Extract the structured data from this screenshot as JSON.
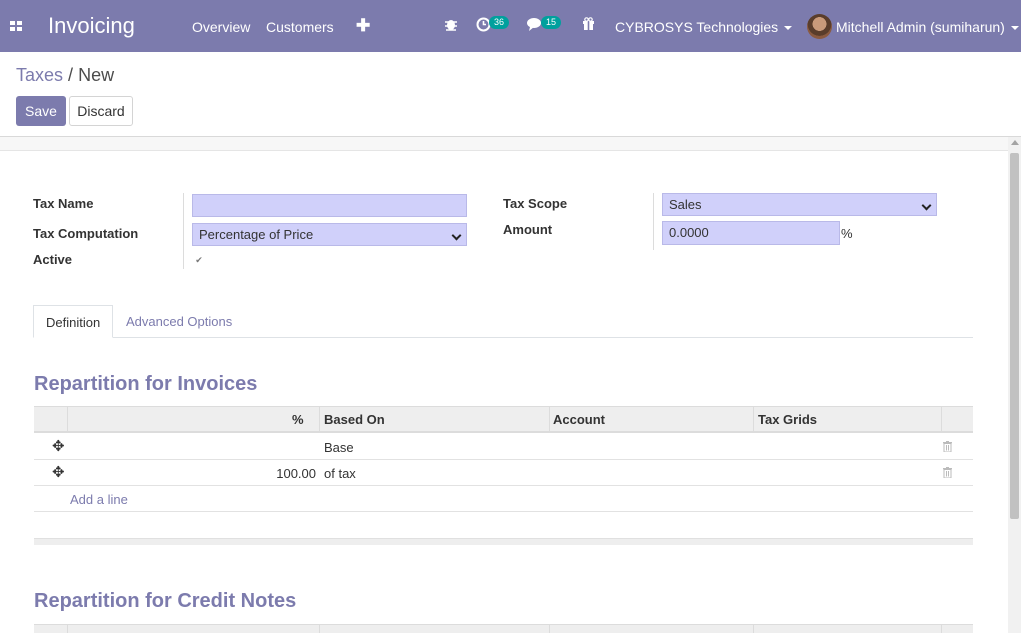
{
  "navbar": {
    "app_name": "Invoicing",
    "menu": [
      "Overview",
      "Customers"
    ],
    "activity_count": "36",
    "messages_count": "15",
    "company": "CYBROSYS Technologies",
    "user": "Mitchell Admin (sumiharun)"
  },
  "breadcrumb": {
    "parent": "Taxes",
    "separator": "/",
    "current": "New"
  },
  "buttons": {
    "save": "Save",
    "discard": "Discard"
  },
  "form": {
    "tax_name_label": "Tax Name",
    "tax_name_value": "",
    "tax_computation_label": "Tax Computation",
    "tax_computation_value": "Percentage of Price",
    "active_label": "Active",
    "active_checked": true,
    "tax_scope_label": "Tax Scope",
    "tax_scope_value": "Sales",
    "amount_label": "Amount",
    "amount_value": "0.0000",
    "amount_unit": "%"
  },
  "tabs": [
    "Definition",
    "Advanced Options"
  ],
  "invoices": {
    "title": "Repartition for Invoices",
    "columns": [
      "%",
      "Based On",
      "Account",
      "Tax Grids"
    ],
    "rows": [
      {
        "percent": "",
        "based_on": "Base",
        "account": "",
        "tax_grids": ""
      },
      {
        "percent": "100.00",
        "based_on": "of tax",
        "account": "",
        "tax_grids": ""
      }
    ],
    "add_line": "Add a line"
  },
  "credit_notes": {
    "title": "Repartition for Credit Notes"
  },
  "colors": {
    "primary": "#7c7bad",
    "field_bg": "#d0d0fa",
    "badge": "#00a09d"
  }
}
